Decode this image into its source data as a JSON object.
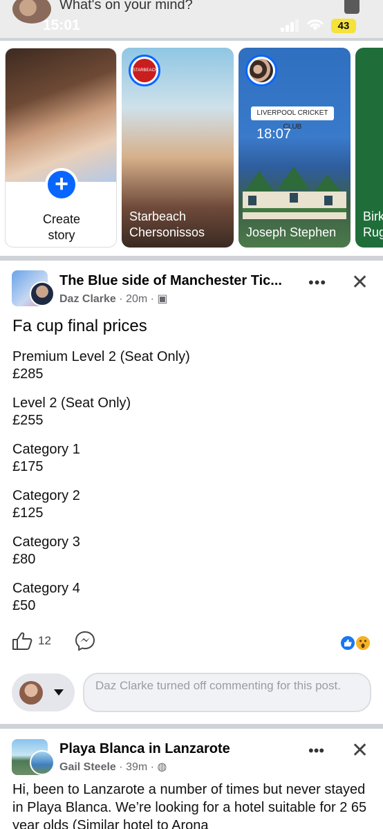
{
  "topbar": {
    "composer_placeholder": "What's on your mind?",
    "time": "15:01",
    "battery": "43"
  },
  "stories": {
    "create_label_line1": "Create",
    "create_label_line2": "story",
    "items": [
      {
        "line1": "Starbeach",
        "line2": "Chersonissos",
        "badge": "STARBEACH"
      },
      {
        "line1": "Joseph Stephen",
        "line2": "",
        "card_text": "LIVERPOOL CRICKET CLUB",
        "clock": "18:07"
      },
      {
        "line1": "Birk",
        "line2": "Rug"
      }
    ]
  },
  "post": {
    "group_name": "The Blue side of Manchester Tic...",
    "author": "Daz Clarke",
    "age": "20m",
    "title": "Fa cup final prices",
    "prices": [
      {
        "label": "Premium Level 2 (Seat Only)",
        "price": "£285"
      },
      {
        "label": "Level 2 (Seat Only)",
        "price": "£255"
      },
      {
        "label": "Category 1",
        "price": "£175"
      },
      {
        "label": "Category 2",
        "price": "£125"
      },
      {
        "label": "Category 3",
        "price": "£80"
      },
      {
        "label": "Category 4",
        "price": "£50"
      }
    ],
    "like_count": "12",
    "comment_notice": "Daz Clarke turned off commenting for this post."
  },
  "post2": {
    "group_name": "Playa Blanca in Lanzarote",
    "author": "Gail Steele",
    "age": "39m",
    "body": "Hi, been to Lanzarote a number of times but never stayed in Playa Blanca. We’re looking for a hotel suitable for 2 65 year olds (Similar hotel to Arona"
  },
  "colors": {
    "accent": "#0866ff",
    "divider": "#cfd2d6",
    "meta_text": "#65676b"
  }
}
